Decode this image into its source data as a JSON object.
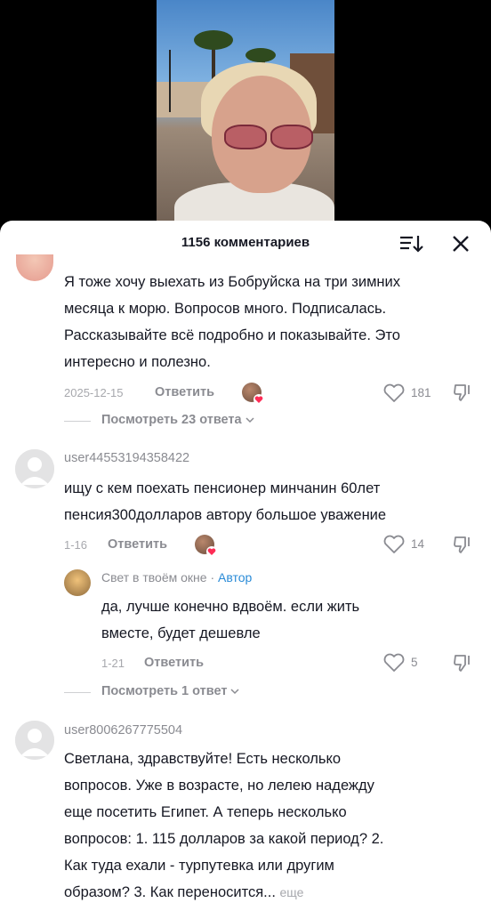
{
  "sheet": {
    "title": "1156 комментариев"
  },
  "comments": [
    {
      "text_lines": [
        "Я тоже хочу выехать из Бобруйска на три зимних",
        "месяца к морю. Вопросов много. Подписалась.",
        "Рассказывайте всё подробно и показывайте. Это",
        "интересно и полезно."
      ],
      "date": "2025-12-15",
      "reply_label": "Ответить",
      "likes": "181",
      "view_replies": "Посмотреть 23 ответа"
    },
    {
      "username": "user44553194358422",
      "text_lines": [
        "ищу с кем поехать пенсионер минчанин 60лет",
        "пенсия300долларов автору большое уважение"
      ],
      "date": "1-16",
      "reply_label": "Ответить",
      "likes": "14",
      "reply": {
        "username": "Свет в твоём окне",
        "separator": " · ",
        "author_label": "Автор",
        "text_lines": [
          "да, лучше конечно вдвоём. если жить",
          "вместе, будет дешевле"
        ],
        "date": "1-21",
        "reply_label": "Ответить",
        "likes": "5"
      },
      "view_replies": "Посмотреть 1 ответ"
    },
    {
      "username": "user8006267775504",
      "text_lines": [
        "Светлана, здравствуйте! Есть несколько",
        "вопросов. Уже в возрасте, но лелею надежду",
        "еще посетить Египет. А теперь несколько",
        "вопросов: 1. 115 долларов за какой период? 2.",
        "Как туда ехали - турпутевка или другим",
        "образом? 3. Как переносится..."
      ],
      "more_label": "еще"
    }
  ],
  "icons": {
    "sort": "sort-icon",
    "close": "close-icon",
    "like": "heart-outline-icon",
    "dislike": "thumbs-down-icon",
    "chevron": "chevron-down-icon",
    "avatar_default": "default-avatar-icon"
  },
  "colors": {
    "author_tag": "#2a8bd7",
    "muted_text": "#8a8b91",
    "primary_text": "#161823"
  }
}
